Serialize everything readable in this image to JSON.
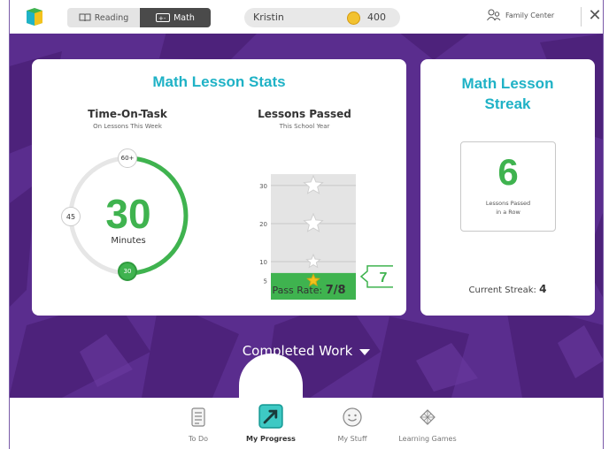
{
  "topbar": {
    "subjects": [
      {
        "label": "Reading",
        "active": false
      },
      {
        "label": "Math",
        "active": true
      }
    ],
    "profile_name": "Kristin",
    "coins": "400",
    "family_center": "Family Center",
    "close_glyph": "✕"
  },
  "stats_card": {
    "title": "Math Lesson Stats",
    "time_on_task": {
      "title": "Time-On-Task",
      "subtitle": "On Lessons This Week",
      "minutes": "30",
      "unit": "Minutes",
      "badge_top": "60+",
      "badge_left": "45",
      "badge_bottom": "30",
      "progress_fraction": 0.5
    },
    "lessons_passed": {
      "title": "Lessons Passed",
      "subtitle": "This School Year",
      "value": "7",
      "pass_rate_label": "Pass Rate:",
      "pass_rate_value": "7/8"
    }
  },
  "chart_data": {
    "type": "bar",
    "categories": [
      "This School Year"
    ],
    "values": [
      7
    ],
    "ylim": [
      0,
      33
    ],
    "yticks": [
      5,
      10,
      20,
      30
    ],
    "milestone_stars": [
      5,
      10,
      20,
      30
    ],
    "title": "Lessons Passed",
    "callout": "7"
  },
  "streak_card": {
    "title_line1": "Math Lesson",
    "title_line2": "Streak",
    "value": "6",
    "label_line1": "Lessons Passed",
    "label_line2": "in a Row",
    "current_label": "Current Streak:",
    "current_value": "4"
  },
  "completed_work": "Completed Work",
  "nav": [
    {
      "label": "To Do",
      "icon": "todo-icon",
      "active": false
    },
    {
      "label": "My Progress",
      "icon": "progress-icon",
      "active": true
    },
    {
      "label": "My Stuff",
      "icon": "smiley-icon",
      "active": false
    },
    {
      "label": "Learning Games",
      "icon": "games-icon",
      "active": false
    }
  ],
  "colors": {
    "purple": "#5a2d8e",
    "teal": "#1fb2c6",
    "green": "#3fb34f",
    "star_gold": "#f3c21c"
  }
}
